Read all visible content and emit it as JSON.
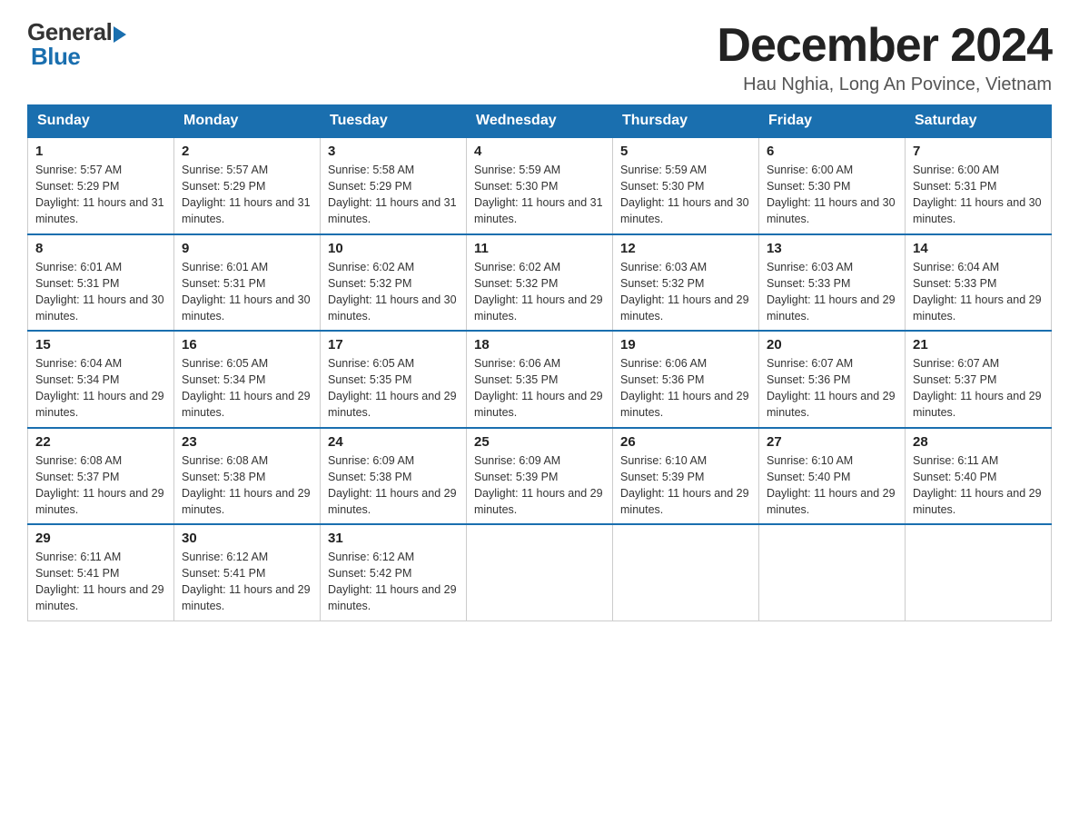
{
  "header": {
    "logo_general": "General",
    "logo_blue": "Blue",
    "month_title": "December 2024",
    "location": "Hau Nghia, Long An Povince, Vietnam"
  },
  "days_of_week": [
    "Sunday",
    "Monday",
    "Tuesday",
    "Wednesday",
    "Thursday",
    "Friday",
    "Saturday"
  ],
  "weeks": [
    [
      {
        "day": "1",
        "sunrise": "5:57 AM",
        "sunset": "5:29 PM",
        "daylight": "11 hours and 31 minutes."
      },
      {
        "day": "2",
        "sunrise": "5:57 AM",
        "sunset": "5:29 PM",
        "daylight": "11 hours and 31 minutes."
      },
      {
        "day": "3",
        "sunrise": "5:58 AM",
        "sunset": "5:29 PM",
        "daylight": "11 hours and 31 minutes."
      },
      {
        "day": "4",
        "sunrise": "5:59 AM",
        "sunset": "5:30 PM",
        "daylight": "11 hours and 31 minutes."
      },
      {
        "day": "5",
        "sunrise": "5:59 AM",
        "sunset": "5:30 PM",
        "daylight": "11 hours and 30 minutes."
      },
      {
        "day": "6",
        "sunrise": "6:00 AM",
        "sunset": "5:30 PM",
        "daylight": "11 hours and 30 minutes."
      },
      {
        "day": "7",
        "sunrise": "6:00 AM",
        "sunset": "5:31 PM",
        "daylight": "11 hours and 30 minutes."
      }
    ],
    [
      {
        "day": "8",
        "sunrise": "6:01 AM",
        "sunset": "5:31 PM",
        "daylight": "11 hours and 30 minutes."
      },
      {
        "day": "9",
        "sunrise": "6:01 AM",
        "sunset": "5:31 PM",
        "daylight": "11 hours and 30 minutes."
      },
      {
        "day": "10",
        "sunrise": "6:02 AM",
        "sunset": "5:32 PM",
        "daylight": "11 hours and 30 minutes."
      },
      {
        "day": "11",
        "sunrise": "6:02 AM",
        "sunset": "5:32 PM",
        "daylight": "11 hours and 29 minutes."
      },
      {
        "day": "12",
        "sunrise": "6:03 AM",
        "sunset": "5:32 PM",
        "daylight": "11 hours and 29 minutes."
      },
      {
        "day": "13",
        "sunrise": "6:03 AM",
        "sunset": "5:33 PM",
        "daylight": "11 hours and 29 minutes."
      },
      {
        "day": "14",
        "sunrise": "6:04 AM",
        "sunset": "5:33 PM",
        "daylight": "11 hours and 29 minutes."
      }
    ],
    [
      {
        "day": "15",
        "sunrise": "6:04 AM",
        "sunset": "5:34 PM",
        "daylight": "11 hours and 29 minutes."
      },
      {
        "day": "16",
        "sunrise": "6:05 AM",
        "sunset": "5:34 PM",
        "daylight": "11 hours and 29 minutes."
      },
      {
        "day": "17",
        "sunrise": "6:05 AM",
        "sunset": "5:35 PM",
        "daylight": "11 hours and 29 minutes."
      },
      {
        "day": "18",
        "sunrise": "6:06 AM",
        "sunset": "5:35 PM",
        "daylight": "11 hours and 29 minutes."
      },
      {
        "day": "19",
        "sunrise": "6:06 AM",
        "sunset": "5:36 PM",
        "daylight": "11 hours and 29 minutes."
      },
      {
        "day": "20",
        "sunrise": "6:07 AM",
        "sunset": "5:36 PM",
        "daylight": "11 hours and 29 minutes."
      },
      {
        "day": "21",
        "sunrise": "6:07 AM",
        "sunset": "5:37 PM",
        "daylight": "11 hours and 29 minutes."
      }
    ],
    [
      {
        "day": "22",
        "sunrise": "6:08 AM",
        "sunset": "5:37 PM",
        "daylight": "11 hours and 29 minutes."
      },
      {
        "day": "23",
        "sunrise": "6:08 AM",
        "sunset": "5:38 PM",
        "daylight": "11 hours and 29 minutes."
      },
      {
        "day": "24",
        "sunrise": "6:09 AM",
        "sunset": "5:38 PM",
        "daylight": "11 hours and 29 minutes."
      },
      {
        "day": "25",
        "sunrise": "6:09 AM",
        "sunset": "5:39 PM",
        "daylight": "11 hours and 29 minutes."
      },
      {
        "day": "26",
        "sunrise": "6:10 AM",
        "sunset": "5:39 PM",
        "daylight": "11 hours and 29 minutes."
      },
      {
        "day": "27",
        "sunrise": "6:10 AM",
        "sunset": "5:40 PM",
        "daylight": "11 hours and 29 minutes."
      },
      {
        "day": "28",
        "sunrise": "6:11 AM",
        "sunset": "5:40 PM",
        "daylight": "11 hours and 29 minutes."
      }
    ],
    [
      {
        "day": "29",
        "sunrise": "6:11 AM",
        "sunset": "5:41 PM",
        "daylight": "11 hours and 29 minutes."
      },
      {
        "day": "30",
        "sunrise": "6:12 AM",
        "sunset": "5:41 PM",
        "daylight": "11 hours and 29 minutes."
      },
      {
        "day": "31",
        "sunrise": "6:12 AM",
        "sunset": "5:42 PM",
        "daylight": "11 hours and 29 minutes."
      },
      null,
      null,
      null,
      null
    ]
  ]
}
